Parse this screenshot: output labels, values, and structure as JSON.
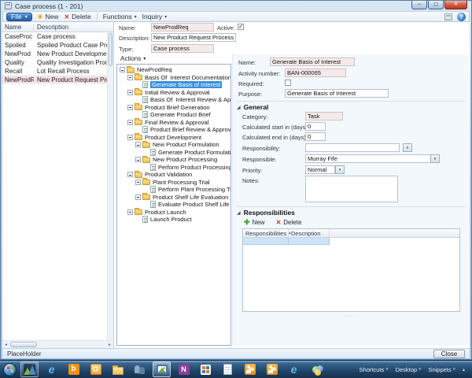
{
  "window": {
    "title": "Case process (1 - 201)"
  },
  "icons": {
    "minimize": "–",
    "maximize": "◻",
    "close": "✕",
    "help": "?",
    "dropdown": "▾",
    "new_star": "✱",
    "delete_x": "✕",
    "plus": "✚",
    "check": "✓",
    "sort_asc": "▴",
    "section_arrow": "◢",
    "scroll_left": "◄",
    "scroll_right": "►",
    "chevron": "»",
    "tray_up": "▴",
    "grid_resize_dots": "····",
    "ie_glyph": "e",
    "bing_glyph": "b",
    "outlook_glyph": "O",
    "onenote_glyph": "N"
  },
  "toolbar": {
    "file": "File",
    "new": "New",
    "delete": "Delete",
    "functions": "Functions",
    "inquiry": "Inquiry"
  },
  "left_table": {
    "columns": [
      "Name",
      "Description"
    ],
    "rows": [
      {
        "name": "CaseProc",
        "description": "Case process"
      },
      {
        "name": "Spoiled",
        "description": "Spoiled Product Case Process"
      },
      {
        "name": "NewProd",
        "description": "New Product Developmet Process"
      },
      {
        "name": "Quality",
        "description": "Quality Investigation Process"
      },
      {
        "name": "Recall",
        "description": "Lot Recall Process"
      },
      {
        "name": "NewProdReq",
        "description": "New Product Request Process"
      }
    ],
    "selected_row": "NewProdReq"
  },
  "top_form": {
    "name_label": "Name:",
    "name_value": "NewProdReq",
    "active_label": "Active:",
    "active_checked": true,
    "description_label": "Description:",
    "description_value": "New Product Request Process",
    "type_label": "Type:",
    "type_value": "Case process"
  },
  "tree": {
    "actions_label": "Actions",
    "items": [
      {
        "label": "NewProdReq",
        "type": "folder",
        "level": 0
      },
      {
        "label": "Basis Of  Interest Documentation",
        "type": "folder",
        "level": 1
      },
      {
        "label": "Generate Basis of Interest",
        "type": "task",
        "level": 2,
        "selected": true
      },
      {
        "label": "Initial Review & Approval",
        "type": "folder",
        "level": 1
      },
      {
        "label": "Basis Of  Interest Review & Approval",
        "type": "task",
        "level": 2
      },
      {
        "label": "Product Brief Generation",
        "type": "folder",
        "level": 1
      },
      {
        "label": "Generate Product Brief",
        "type": "task",
        "level": 2
      },
      {
        "label": "Final Review & Approval",
        "type": "folder",
        "level": 1
      },
      {
        "label": "Product Brief Review & Approval",
        "type": "task",
        "level": 2
      },
      {
        "label": "Product Development",
        "type": "folder",
        "level": 1
      },
      {
        "label": "New Product Formulation",
        "type": "folder",
        "level": 2
      },
      {
        "label": "Generate Product Formulation",
        "type": "task",
        "level": 3
      },
      {
        "label": "New Product Processing",
        "type": "folder",
        "level": 2
      },
      {
        "label": "Perform Product Processing Review",
        "type": "task",
        "level": 3
      },
      {
        "label": "Product Validation",
        "type": "folder",
        "level": 1
      },
      {
        "label": "Plant Processing Trial",
        "type": "folder",
        "level": 2
      },
      {
        "label": "Perform Plant Processing Trial",
        "type": "task",
        "level": 3
      },
      {
        "label": "Product Shelf Life Evaluation",
        "type": "folder",
        "level": 2
      },
      {
        "label": "Evaluate Product Shelf Life",
        "type": "task",
        "level": 3
      },
      {
        "label": "Product Launch",
        "type": "folder",
        "level": 1
      },
      {
        "label": "Launch Product",
        "type": "task",
        "level": 2
      }
    ]
  },
  "detail": {
    "name_label": "Name:",
    "name_value": "Generate Basis of Interest",
    "activity_label": "Activity number:",
    "activity_value": "BAN-000065",
    "required_label": "Required:",
    "required_checked": false,
    "purpose_label": "Purpose:",
    "purpose_value": "Generate Basis of Interest",
    "general": {
      "title": "General",
      "category_label": "Category:",
      "category_value": "Task",
      "calc_start_label": "Calculated start in (days):",
      "calc_start_value": "0",
      "calc_end_label": "Calculated end in (days):",
      "calc_end_value": "0",
      "responsibility_label": "Responsibility:",
      "responsibility_value": "",
      "responsible_label": "Responsible:",
      "responsible_value": "Murray Fife",
      "priority_label": "Priority:",
      "priority_value": "Normal",
      "notes_label": "Notes:",
      "notes_value": ""
    },
    "responsibilities": {
      "title": "Responsibilities",
      "new_label": "New",
      "delete_label": "Delete",
      "columns": [
        "Responsibilities",
        "Description"
      ],
      "rows": []
    }
  },
  "statusbar": {
    "text": "PlaceHolder",
    "close_label": "Close"
  },
  "taskbar": {
    "apps": [
      {
        "name": "start-orb"
      },
      {
        "name": "dynamics-ax-app",
        "state": "open"
      },
      {
        "name": "internet-explorer"
      },
      {
        "name": "bing"
      },
      {
        "name": "outlook"
      },
      {
        "name": "explorer-folder"
      },
      {
        "name": "contacts-app"
      },
      {
        "name": "image-app",
        "state": "active"
      },
      {
        "name": "onenote"
      },
      {
        "name": "grid-app"
      },
      {
        "name": "document-app"
      },
      {
        "name": "people-app-orange-1"
      },
      {
        "name": "people-app-orange-2"
      },
      {
        "name": "internet-explorer-2"
      },
      {
        "name": "spheres-app"
      }
    ],
    "tray": [
      {
        "label": "Shortcuts"
      },
      {
        "label": "Desktop"
      },
      {
        "label": "Snippets"
      }
    ]
  },
  "colors": {
    "titlebar_glass": "#b7cfe6",
    "accent_blue": "#2f6fba",
    "readonly_field": "#f5eaea",
    "selected_row": "#f5e2e2",
    "tree_selection": "#3a90dc",
    "detail_panel_bg": "#f3f8fc",
    "taskbar_dark": "#1f4569",
    "new_star": "#f2a71c",
    "delete_red": "#cc3422",
    "plus_green": "#3da52f"
  }
}
